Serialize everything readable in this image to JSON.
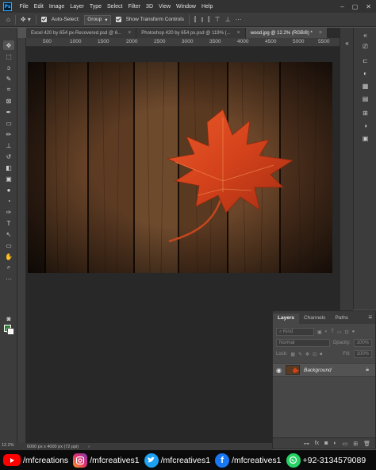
{
  "app": {
    "logo": "Ps"
  },
  "menu": [
    "File",
    "Edit",
    "Image",
    "Layer",
    "Type",
    "Select",
    "Filter",
    "3D",
    "View",
    "Window",
    "Help"
  ],
  "options": {
    "auto_select_label": "Auto-Select:",
    "auto_select_value": "Group",
    "transform_label": "Show Transform Controls"
  },
  "tabs": [
    {
      "label": "Excel 420 by 654 px-Recovered.psd @ 6...",
      "close": "×"
    },
    {
      "label": "Photoshop 420 by 654 px.psd @ 119% (...",
      "close": "×"
    },
    {
      "label": "wood.jpg @ 12.2% (RGB/8) *",
      "close": "×"
    }
  ],
  "ruler": [
    "500",
    "1000",
    "1500",
    "2000",
    "2500",
    "3000",
    "3500",
    "4000",
    "4500",
    "5000",
    "5500"
  ],
  "layers_panel": {
    "tabs": [
      "Layers",
      "Channels",
      "Paths"
    ],
    "kind_label": "Kind",
    "blend_mode": "Normal",
    "opacity_label": "Opacity:",
    "opacity_value": "100%",
    "lock_label": "Lock:",
    "fill_label": "Fill:",
    "fill_value": "100%",
    "layer_name": "Background"
  },
  "status": {
    "zoom": "12.2%",
    "doc_info": "6000 px x 4000 px (72 ppi)"
  },
  "footer": {
    "youtube": "/mfcreations",
    "instagram": "/mfcreatives1",
    "twitter": "/mfcreatives1",
    "facebook": "/mfcreatives1",
    "whatsapp": "+92-3134579089"
  },
  "colors": {
    "foreground": "#2e7d32",
    "background": "#ffffff",
    "accent": "#31a8ff"
  }
}
